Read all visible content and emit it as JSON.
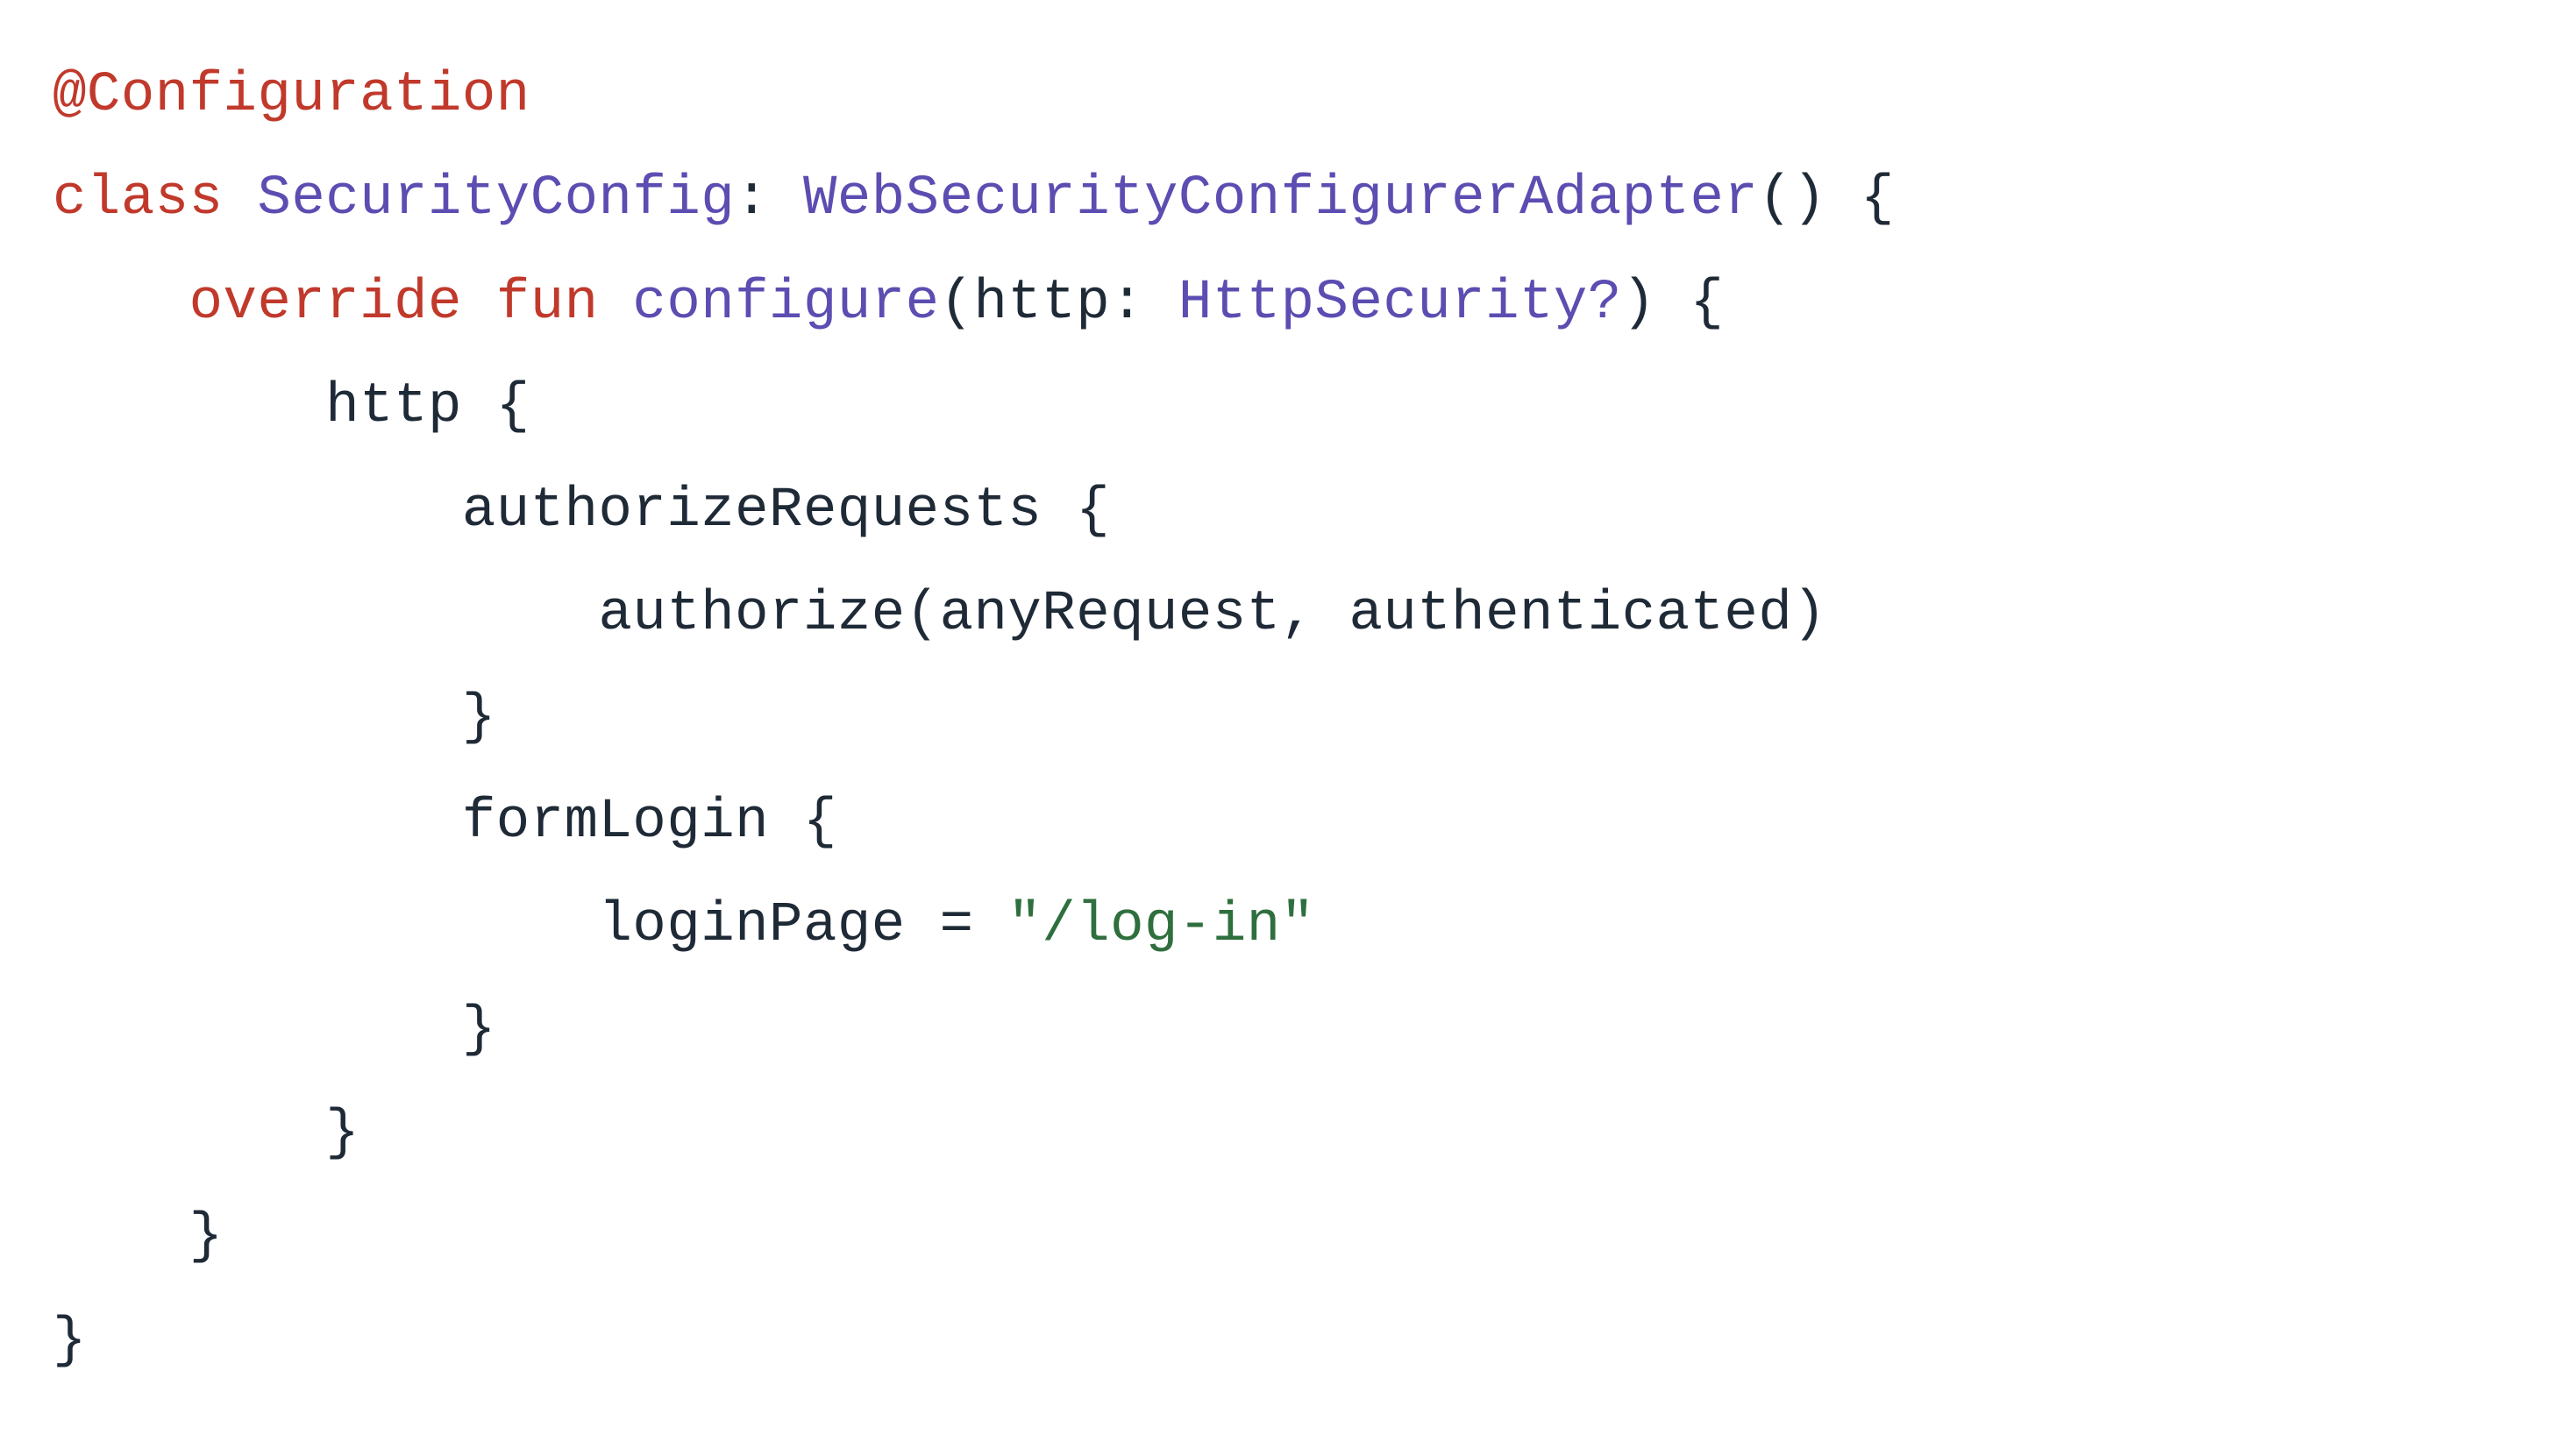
{
  "code": {
    "language": "kotlin",
    "lines": [
      {
        "indent": 0,
        "tokens": [
          {
            "t": "@Configuration",
            "c": "annotation"
          }
        ]
      },
      {
        "indent": 0,
        "tokens": [
          {
            "t": "class ",
            "c": "keyword"
          },
          {
            "t": "SecurityConfig",
            "c": "type"
          },
          {
            "t": ": ",
            "c": "ident"
          },
          {
            "t": "WebSecurityConfigurerAdapter",
            "c": "type"
          },
          {
            "t": "() {",
            "c": "ident"
          }
        ]
      },
      {
        "indent": 1,
        "tokens": [
          {
            "t": "override ",
            "c": "keyword"
          },
          {
            "t": "fun ",
            "c": "keyword"
          },
          {
            "t": "configure",
            "c": "type"
          },
          {
            "t": "(http: ",
            "c": "ident"
          },
          {
            "t": "HttpSecurity?",
            "c": "type"
          },
          {
            "t": ") {",
            "c": "ident"
          }
        ]
      },
      {
        "indent": 2,
        "tokens": [
          {
            "t": "http {",
            "c": "ident"
          }
        ]
      },
      {
        "indent": 3,
        "tokens": [
          {
            "t": "authorizeRequests {",
            "c": "ident"
          }
        ]
      },
      {
        "indent": 4,
        "tokens": [
          {
            "t": "authorize(anyRequest, authenticated)",
            "c": "ident"
          }
        ]
      },
      {
        "indent": 3,
        "tokens": [
          {
            "t": "}",
            "c": "ident"
          }
        ]
      },
      {
        "indent": 3,
        "tokens": [
          {
            "t": "formLogin {",
            "c": "ident"
          }
        ]
      },
      {
        "indent": 4,
        "tokens": [
          {
            "t": "loginPage = ",
            "c": "ident"
          },
          {
            "t": "\"/log-in\"",
            "c": "string"
          }
        ]
      },
      {
        "indent": 3,
        "tokens": [
          {
            "t": "}",
            "c": "ident"
          }
        ]
      },
      {
        "indent": 2,
        "tokens": [
          {
            "t": "}",
            "c": "ident"
          }
        ]
      },
      {
        "indent": 1,
        "tokens": [
          {
            "t": "}",
            "c": "ident"
          }
        ]
      },
      {
        "indent": 0,
        "tokens": [
          {
            "t": "}",
            "c": "ident"
          }
        ]
      }
    ],
    "indent_unit": "    "
  }
}
